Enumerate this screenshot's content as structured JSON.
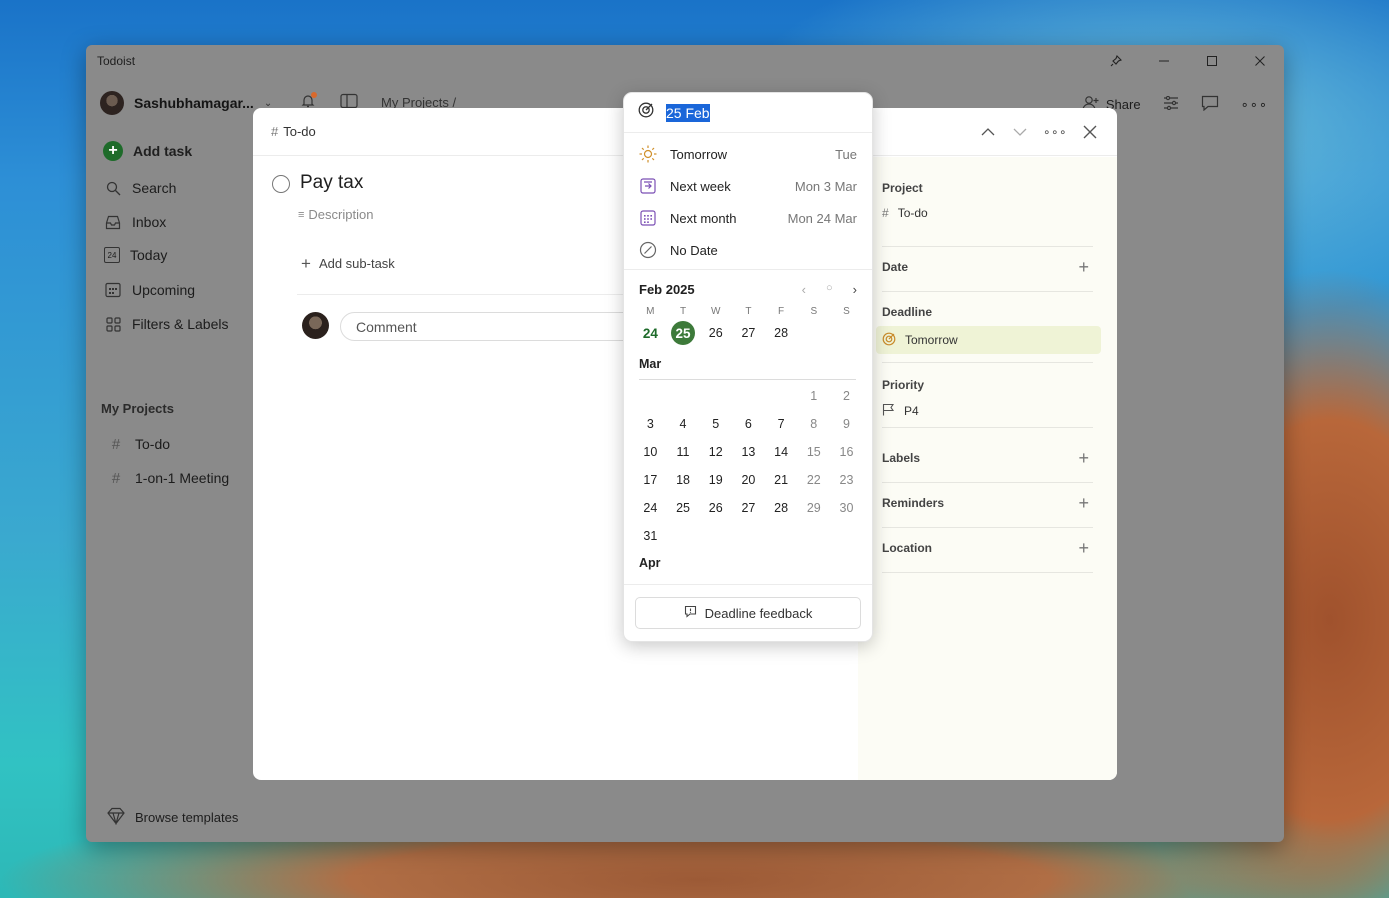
{
  "window": {
    "title": "Todoist"
  },
  "sidebar": {
    "user_name": "Sashubhamagar...",
    "add_task": "Add task",
    "items": [
      {
        "label": "Search"
      },
      {
        "label": "Inbox"
      },
      {
        "label": "Today",
        "badge": "24"
      },
      {
        "label": "Upcoming"
      },
      {
        "label": "Filters & Labels"
      }
    ],
    "projects_heading": "My Projects",
    "projects": [
      {
        "label": "To-do"
      },
      {
        "label": "1-on-1 Meeting"
      }
    ],
    "browse_templates": "Browse templates"
  },
  "topbar": {
    "breadcrumb": "My Projects /",
    "share": "Share"
  },
  "task_modal": {
    "project_crumb": "To-do",
    "title": "Pay tax",
    "description_placeholder": "Description",
    "add_subtask": "Add sub-task",
    "comment_placeholder": "Comment",
    "side": {
      "project_label": "Project",
      "project_value": "To-do",
      "date_label": "Date",
      "deadline_label": "Deadline",
      "deadline_value": "Tomorrow",
      "priority_label": "Priority",
      "priority_value": "P4",
      "labels_label": "Labels",
      "reminders_label": "Reminders",
      "location_label": "Location"
    }
  },
  "date_picker": {
    "input_value": "25 Feb",
    "quick_options": [
      {
        "label": "Tomorrow",
        "date": "Tue",
        "icon": "sun-icon"
      },
      {
        "label": "Next week",
        "date": "Mon 3 Mar",
        "icon": "next-week-icon"
      },
      {
        "label": "Next month",
        "date": "Mon 24 Mar",
        "icon": "calendar-grid-icon"
      },
      {
        "label": "No Date",
        "date": "",
        "icon": "no-date-icon"
      }
    ],
    "month_header": "Feb 2025",
    "weekdays": [
      "M",
      "T",
      "W",
      "T",
      "F",
      "S",
      "S"
    ],
    "feb_days": [
      "24",
      "25",
      "26",
      "27",
      "28"
    ],
    "today": "24",
    "selected": "25",
    "mar_label": "Mar",
    "mar_rows": [
      [
        "",
        "",
        "",
        "",
        "",
        "1",
        "2"
      ],
      [
        "3",
        "4",
        "5",
        "6",
        "7",
        "8",
        "9"
      ],
      [
        "10",
        "11",
        "12",
        "13",
        "14",
        "15",
        "16"
      ],
      [
        "17",
        "18",
        "19",
        "20",
        "21",
        "22",
        "23"
      ],
      [
        "24",
        "25",
        "26",
        "27",
        "28",
        "29",
        "30"
      ],
      [
        "31",
        "",
        "",
        "",
        "",
        "",
        ""
      ]
    ],
    "apr_label": "Apr",
    "feedback": "Deadline feedback"
  },
  "colors": {
    "accent_green": "#3d7a3a",
    "selection_blue": "#1a66d9",
    "deadline_bg": "#eff3d6"
  }
}
